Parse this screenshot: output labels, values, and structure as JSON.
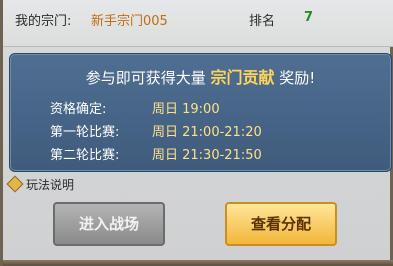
{
  "header": {
    "guild_label": "我的宗门:",
    "guild_value": "新手宗门005",
    "rank_label": "排名",
    "rank_value": "7"
  },
  "panel": {
    "title_prefix": "参与即可获得大量",
    "title_highlight": "宗门贡献",
    "title_suffix": "奖励!",
    "rows": [
      {
        "label": "资格确定:",
        "value": "周日 19:00"
      },
      {
        "label": "第一轮比赛:",
        "value": "周日 21:00-21:20"
      },
      {
        "label": "第二轮比赛:",
        "value": "周日 21:30-21:50"
      }
    ]
  },
  "help": {
    "label": "玩法说明",
    "icon": "diamond-icon"
  },
  "buttons": {
    "enter_label": "进入战场",
    "view_label": "查看分配"
  }
}
